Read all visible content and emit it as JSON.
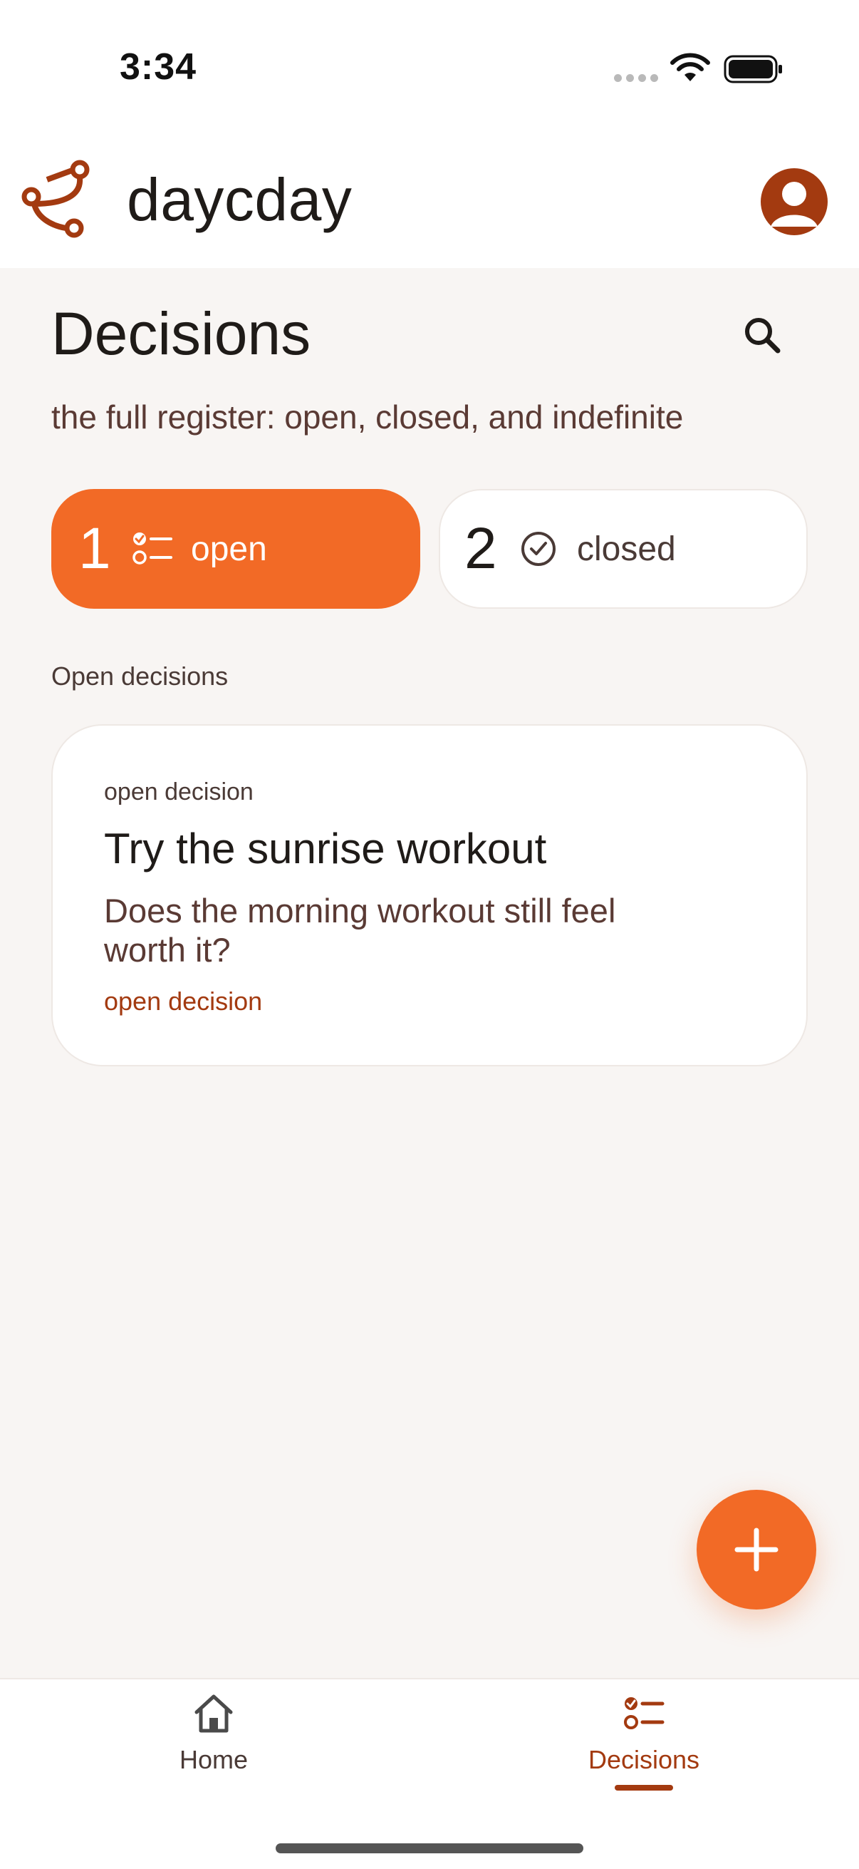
{
  "status_bar": {
    "time": "3:34"
  },
  "app": {
    "title": "daycday",
    "accent": "#f26a26",
    "brand": "#a33a10"
  },
  "page": {
    "title": "Decisions",
    "subtitle": "the full register: open, closed, and indefinite"
  },
  "filters": [
    {
      "count": "1",
      "label": "open",
      "icon": "checklist-icon",
      "selected": true
    },
    {
      "count": "2",
      "label": "closed",
      "icon": "check-circle-icon",
      "selected": false
    }
  ],
  "section": {
    "label": "Open decisions"
  },
  "cards": [
    {
      "eyebrow": "open decision",
      "title": "Try the sunrise workout",
      "body": "Does the morning workout still feel worth it?",
      "status": "open decision"
    }
  ],
  "nav": [
    {
      "label": "Home",
      "icon": "home-icon",
      "active": false
    },
    {
      "label": "Decisions",
      "icon": "checklist-icon",
      "active": true
    }
  ]
}
